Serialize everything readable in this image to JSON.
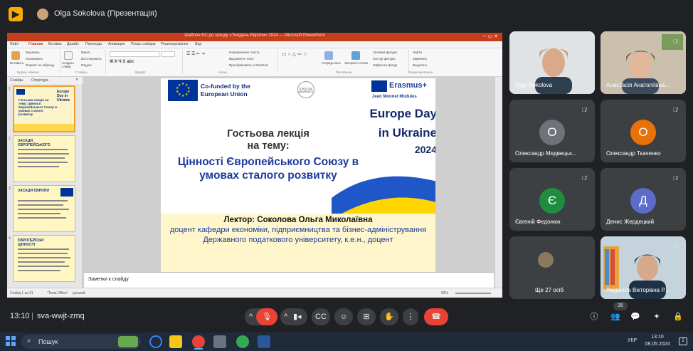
{
  "topbar": {
    "title": "Olga Sokolova (Презентація)"
  },
  "powerpoint": {
    "title": "Шаблон ЄС до заходу «Тиждень Європи» 2024 — Microsoft PowerPoint",
    "tabs": [
      "Файл",
      "Главная",
      "Вставка",
      "Дизайн",
      "Переходы",
      "Анимация",
      "Показ слайдов",
      "Рецензирование",
      "Вид"
    ],
    "ribbon": {
      "paste": "Вставить",
      "cut": "Вырезать",
      "copy": "Копировать",
      "format_painter": "Формат по образцу",
      "new_slide": "Создать слайд",
      "layout": "Макет",
      "reset": "Восстановить",
      "section": "Раздел",
      "group_clipboard": "Буфер обмена",
      "group_slides": "Слайды",
      "group_font": "Шрифт",
      "group_paragraph": "Абзац",
      "group_drawing": "Рисование",
      "group_editing": "Редактирование",
      "arrange": "Упорядочить",
      "quick_styles": "Экспресс-стили",
      "shape_fill": "Заливка фигуры",
      "shape_outline": "Контур фигуры",
      "shape_effects": "Эффекты фигур",
      "find": "Найти",
      "replace": "Заменить",
      "select": "Выделить",
      "text_direction": "Направление текста",
      "align_text": "Выровнять текст",
      "smartart": "Преобразовать в SmartArt"
    },
    "thumb_tabs": [
      "Слайды",
      "Структура"
    ],
    "thumbs": [
      {
        "num": "1",
        "title": "Гостьова лекція на тему: Цінності Європейського Союзу в умовах сталого розвитку"
      },
      {
        "num": "2",
        "title": "ЗАСАДИ ЄВРОПЕЙСЬКОГО"
      },
      {
        "num": "3",
        "title": "ЗАСАДИ ЄВРОПИ"
      },
      {
        "num": "4",
        "title": "ЄВРОПЕЙСЬКІ ЦІННОСТІ"
      }
    ],
    "notes_label": "Заметки к слайду",
    "status": {
      "slide": "Слайд 1 из 31",
      "theme": "\"Тема Office\"",
      "lang": "русский",
      "zoom": "59%"
    },
    "slide": {
      "cofunded": "Co-funded by the European Union",
      "uni": "STATE TAX UNIVERSITY",
      "erasmus": "Erasmus+",
      "jean_monnet": "Jean Monnet Modules",
      "event_line1": "Europe Day",
      "event_line2": "in Ukraine",
      "event_year": "2024",
      "lecture_line1": "Гостьова лекція",
      "lecture_line2": "на тему:",
      "topic": "Цінності Європейського Союзу в умовах сталого розвитку",
      "lector": "Лектор: Соколова Ольга Миколаївна",
      "lector_sub": "доцент кафедри економіки, підприємництва та бізнес-адміністрування Державного податкового університету, к.е.н., доцент"
    }
  },
  "participants": [
    {
      "name": "Olga Sokolova",
      "type": "video"
    },
    {
      "name": "Анастасія Анатоліївна...",
      "type": "video"
    },
    {
      "name": "Олександр Медвецьк...",
      "initial": "О",
      "color": "#6d7378"
    },
    {
      "name": "Олександр Ткаченко",
      "initial": "О",
      "color": "#e8710a"
    },
    {
      "name": "Євгеній Федонюк",
      "initial": "Є",
      "color": "#1e8e3e"
    },
    {
      "name": "Денис Жердецкий",
      "initial": "Д",
      "color": "#5b6dc8"
    },
    {
      "name": "Ще 27 осіб",
      "type": "more"
    },
    {
      "name": "Людмила Вікторівна Р...",
      "type": "video"
    }
  ],
  "bottombar": {
    "time": "13:10",
    "meeting_code": "sva-wwjt-zmq",
    "people_count": "35"
  },
  "taskbar": {
    "search_placeholder": "Пошук",
    "lang": "УКР",
    "time": "13:10",
    "date": "08.05.2024",
    "notif": "2"
  },
  "colors": {
    "bg": "#202124",
    "tile": "#3c4043",
    "danger": "#ea4335",
    "accent": "#f9ab00"
  }
}
